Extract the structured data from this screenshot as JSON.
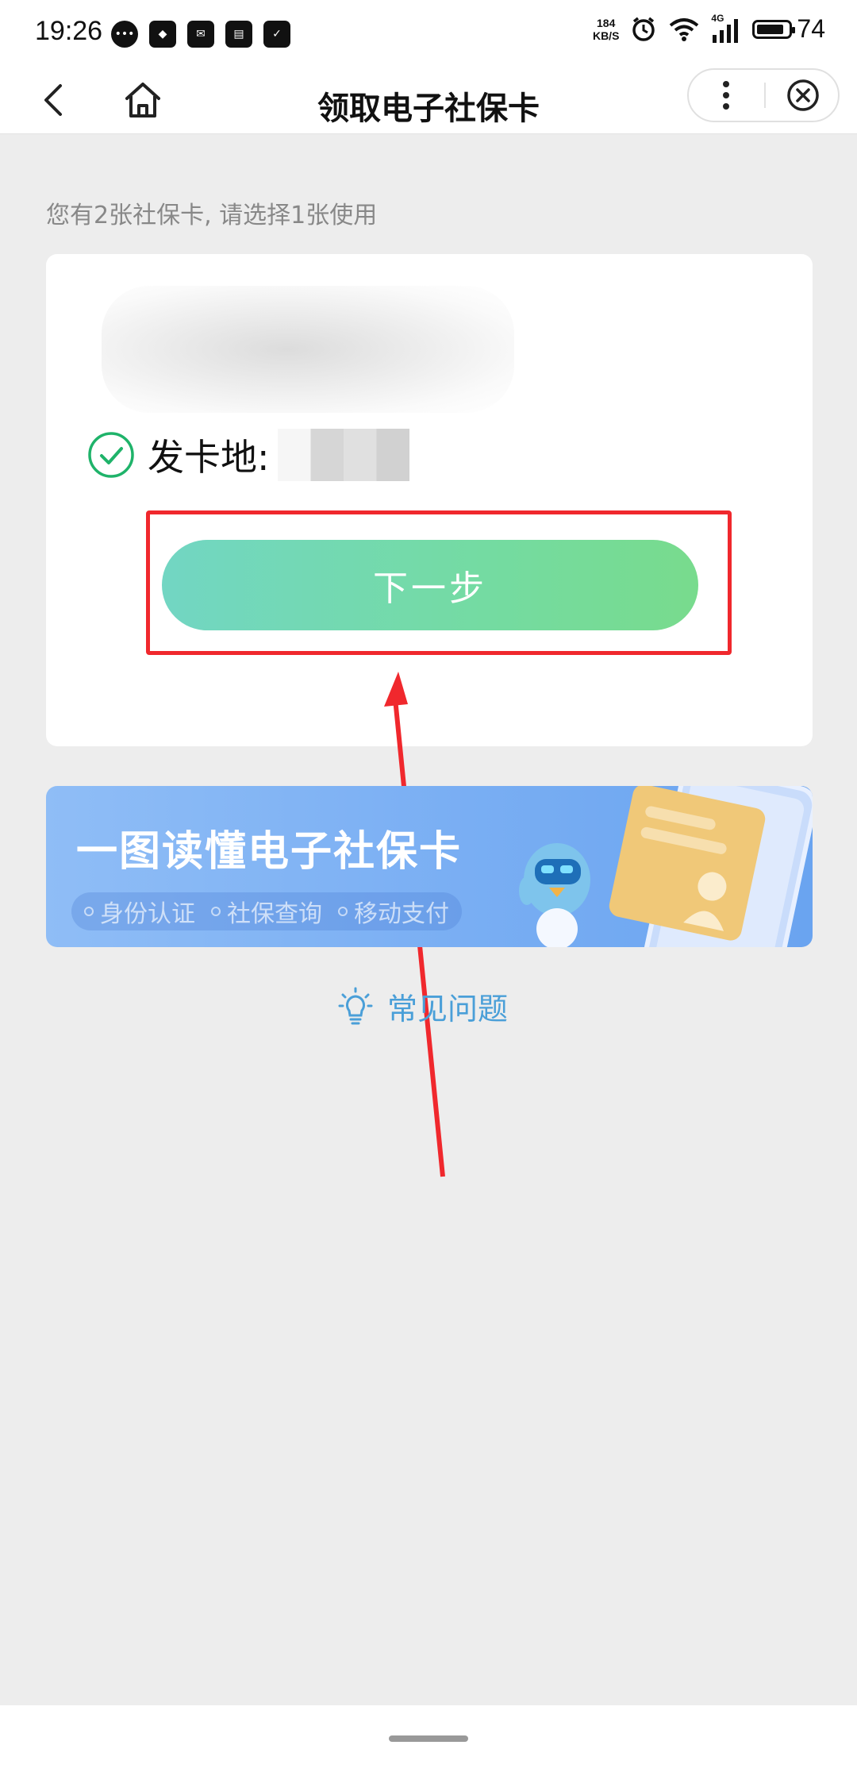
{
  "status_bar": {
    "time": "19:26",
    "net_speed_value": "184",
    "net_speed_unit": "KB/S",
    "network_type": "4G",
    "battery": "74"
  },
  "nav": {
    "title": "领取电子社保卡"
  },
  "hint": "您有2张社保卡, 请选择1张使用",
  "card": {
    "issue_label": "发卡地:",
    "next_button_label": "下一步"
  },
  "banner": {
    "title": "一图读懂电子社保卡",
    "tags": [
      "身份认证",
      "社保查询",
      "移动支付"
    ]
  },
  "faq_label": "常见问题",
  "colors": {
    "primary_green": "#75d9a8",
    "annotation_red": "#f0282d",
    "link_blue": "#4a9fd8",
    "banner_blue": "#79aef3"
  }
}
